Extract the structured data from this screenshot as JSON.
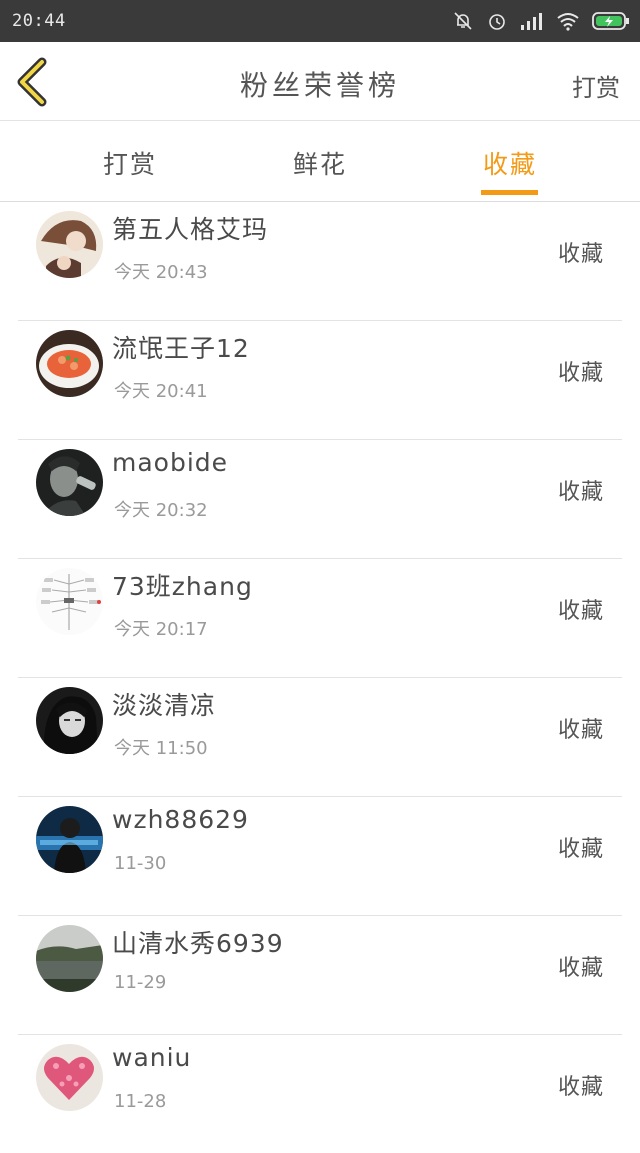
{
  "status_bar": {
    "time": "20:44",
    "icons": [
      "mute-icon",
      "alarm-icon",
      "signal-icon",
      "wifi-icon",
      "battery-icon"
    ]
  },
  "header": {
    "title": "粉丝荣誉榜",
    "right_action": "打赏"
  },
  "tabs": [
    {
      "label": "打赏",
      "active": false
    },
    {
      "label": "鲜花",
      "active": false
    },
    {
      "label": "收藏",
      "active": true
    }
  ],
  "colors": {
    "accent": "#f39a17",
    "statusbar": "#3a3a3a",
    "text": "#4a4a4a",
    "subtext": "#9a9a9a"
  },
  "entries": [
    {
      "name": "第五人格艾玛",
      "time": "今天 20:43",
      "tag": "收藏"
    },
    {
      "name": "流氓王子12",
      "time": "今天 20:41",
      "tag": "收藏"
    },
    {
      "name": "maobide",
      "time": "今天 20:32",
      "tag": "收藏"
    },
    {
      "name": "73班zhang",
      "time": "今天 20:17",
      "tag": "收藏"
    },
    {
      "name": "淡淡清凉",
      "time": "今天 11:50",
      "tag": "收藏"
    },
    {
      "name": "wzh88629",
      "time": "11-30",
      "tag": "收藏"
    },
    {
      "name": "山清水秀6939",
      "time": "11-29",
      "tag": "收藏"
    },
    {
      "name": "waniu",
      "time": "11-28",
      "tag": "收藏"
    }
  ]
}
